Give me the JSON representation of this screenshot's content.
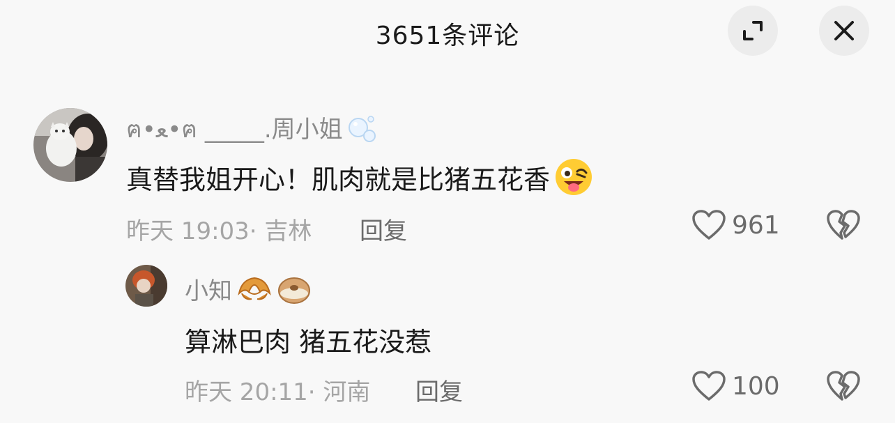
{
  "header": {
    "title": "3651条评论",
    "expand_icon": "expand-icon",
    "close_icon": "close-icon"
  },
  "comments": [
    {
      "username": "ฅ•ﻌ•ฅ _____.周小姐",
      "username_badge": "bubbles-icon",
      "text": "真替我姐开心！肌肉就是比猪五花香",
      "text_emoji": "winking-tongue-emoji",
      "meta": "昨天 19:03· 吉林",
      "reply_label": "回复",
      "like_count": "961",
      "avatar": "avatar-woman-with-cat"
    },
    {
      "username": "小知",
      "username_badges": [
        "croissant-icon",
        "bagel-icon"
      ],
      "text": "算淋巴肉 猪五花没惹",
      "meta": "昨天 20:11· 河南",
      "reply_label": "回复",
      "like_count": "100",
      "avatar": "avatar-girl-helmet"
    }
  ]
}
